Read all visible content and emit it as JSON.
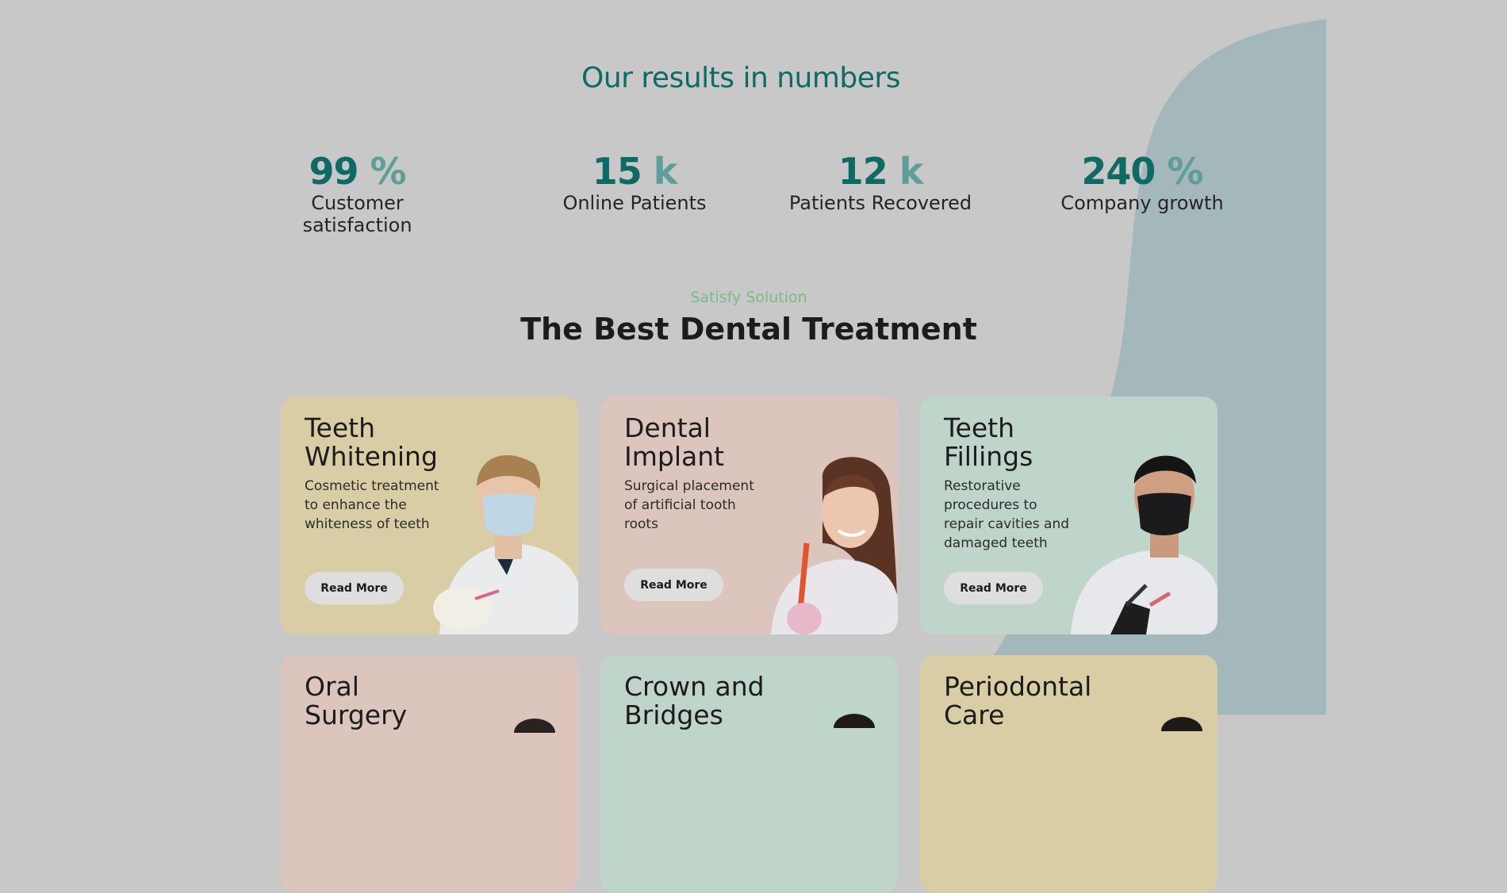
{
  "stats_section": {
    "title": "Our results in numbers",
    "stats": [
      {
        "number": "99",
        "unit": "%",
        "label": "Customer satisfaction"
      },
      {
        "number": "15",
        "unit": "k",
        "label": "Online Patients"
      },
      {
        "number": "12",
        "unit": "k",
        "label": "Patients Recovered"
      },
      {
        "number": "240",
        "unit": "%",
        "label": "Company growth"
      }
    ]
  },
  "treatment_section": {
    "eyebrow": "Satisfy Solution",
    "title": "The Best Dental Treatment",
    "cards": [
      {
        "title_line1": "Teeth",
        "title_line2": "Whitening",
        "description": "Cosmetic treatment to enhance the whiteness of teeth",
        "button": "Read More"
      },
      {
        "title_line1": "Dental",
        "title_line2": "Implant",
        "description": "Surgical placement of artificial tooth roots",
        "button": "Read More"
      },
      {
        "title_line1": "Teeth",
        "title_line2": "Fillings",
        "description": "Restorative procedures to repair cavities and damaged teeth",
        "button": "Read More"
      },
      {
        "title_line1": "Oral",
        "title_line2": "Surgery",
        "description": "",
        "button": ""
      },
      {
        "title_line1": "Crown and",
        "title_line2": "Bridges",
        "description": "",
        "button": ""
      },
      {
        "title_line1": "Periodontal",
        "title_line2": "Care",
        "description": "",
        "button": ""
      }
    ]
  },
  "colors": {
    "page_background": "#c8c8c8",
    "blob": "#a4b8bb",
    "accent_teal": "#0f6a66",
    "accent_teal_light": "#5f9e98",
    "eyebrow_green": "#7bbb84",
    "card_yellow": "#d9cda5",
    "card_pink": "#dbc5bd",
    "card_green": "#bfd5c9"
  }
}
